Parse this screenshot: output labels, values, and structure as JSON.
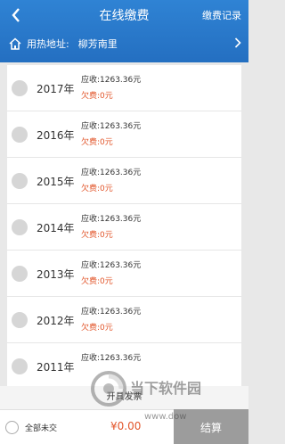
{
  "header": {
    "title": "在线缴费",
    "history_label": "缴费记录"
  },
  "address": {
    "label": "用热地址:",
    "value": "柳芳南里"
  },
  "bills": [
    {
      "year": "2017年",
      "receivable": "应收:1263.36元",
      "owed": "欠费:0元"
    },
    {
      "year": "2016年",
      "receivable": "应收:1263.36元",
      "owed": "欠费:0元"
    },
    {
      "year": "2015年",
      "receivable": "应收:1263.36元",
      "owed": "欠费:0元"
    },
    {
      "year": "2014年",
      "receivable": "应收:1263.36元",
      "owed": "欠费:0元"
    },
    {
      "year": "2013年",
      "receivable": "应收:1263.36元",
      "owed": "欠费:0元"
    },
    {
      "year": "2012年",
      "receivable": "应收:1263.36元",
      "owed": "欠费:0元"
    },
    {
      "year": "2011年",
      "receivable": "应收:1263.36元",
      "owed": ""
    }
  ],
  "invoice_label": "开具发票",
  "footer": {
    "select_all_label": "全部未交",
    "total": "¥0.00",
    "pay_label": "结算"
  },
  "watermark": {
    "text": "当下软件园",
    "site": "www.dow"
  },
  "colors": {
    "header": "#2a79cb",
    "owed": "#e2552a",
    "pay_button": "#9c9c9c"
  }
}
